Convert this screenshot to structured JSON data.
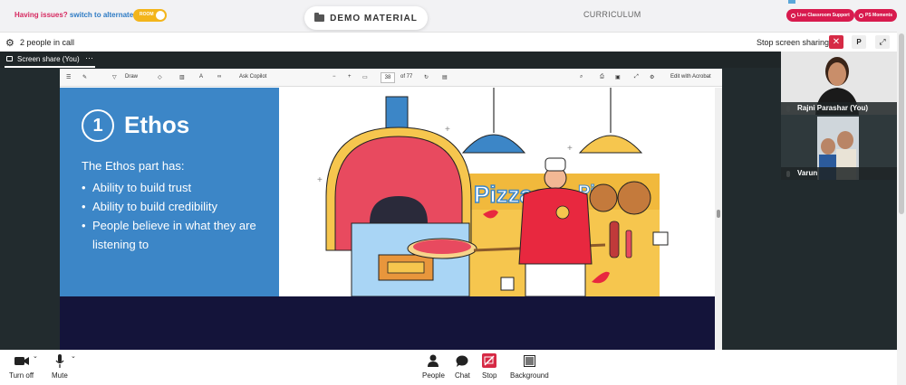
{
  "topbar": {
    "issues_text": "Having issues?",
    "switch_link": "switch to alternate room",
    "toggle_label": "ROOM",
    "demo_material": "DEMO MATERIAL",
    "curriculum": "CURRICULUM",
    "live_support": "Live Classroom Support",
    "ps_moments": "PS Moments"
  },
  "callbar": {
    "people_count": "2 people in call",
    "stop_sharing": "Stop screen sharing",
    "close_symbol": "✕",
    "p_label": "P",
    "expand_symbol": "⤢"
  },
  "share_tab": {
    "label": "Screen share (You)",
    "more": "···"
  },
  "pdf_toolbar": {
    "draw": "Draw",
    "ask_copilot": "Ask Copilot",
    "minus": "−",
    "plus": "+",
    "page": "38",
    "of_pages": "of 77",
    "edit_acrobat": "Edit with Acrobat"
  },
  "slide": {
    "number": "1",
    "title": "Ethos",
    "intro": "The Ethos part has:",
    "bullets": [
      "Ability to build trust",
      "Ability to build credibility",
      "People believe in what they are listening to"
    ],
    "pizza_sign": "Pizza",
    "pizza_sign2": "Piz"
  },
  "participants": [
    {
      "name": "Rajni Parashar (You)"
    },
    {
      "name": "Varun"
    }
  ],
  "controls": {
    "turn_off": "Turn off",
    "mute": "Mute",
    "people": "People",
    "chat": "Chat",
    "stop": "Stop",
    "background": "Background"
  },
  "colors": {
    "slide_blue": "#3c86c7",
    "accent_red": "#d81b4e",
    "navy": "#14143a"
  }
}
